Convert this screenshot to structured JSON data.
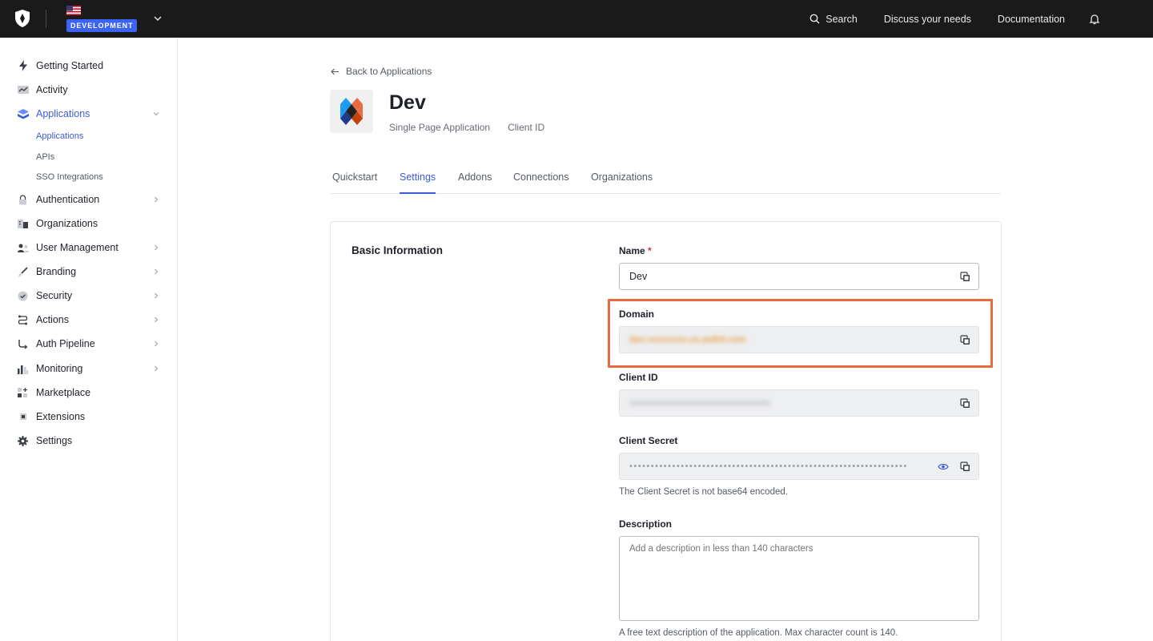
{
  "topbar": {
    "env_badge": "DEVELOPMENT",
    "search_label": "Search",
    "discuss_label": "Discuss your needs",
    "docs_label": "Documentation"
  },
  "sidebar": {
    "items": [
      {
        "label": "Getting Started",
        "icon": "bolt-icon"
      },
      {
        "label": "Activity",
        "icon": "activity-chart-icon"
      },
      {
        "label": "Applications",
        "icon": "layers-icon"
      },
      {
        "label": "Authentication",
        "icon": "lock-icon"
      },
      {
        "label": "Organizations",
        "icon": "building-icon"
      },
      {
        "label": "User Management",
        "icon": "users-icon"
      },
      {
        "label": "Branding",
        "icon": "brush-icon"
      },
      {
        "label": "Security",
        "icon": "shield-check-icon"
      },
      {
        "label": "Actions",
        "icon": "flow-icon"
      },
      {
        "label": "Auth Pipeline",
        "icon": "pipeline-icon"
      },
      {
        "label": "Monitoring",
        "icon": "bar-chart-icon"
      },
      {
        "label": "Marketplace",
        "icon": "grid-plus-icon"
      },
      {
        "label": "Extensions",
        "icon": "chip-icon"
      },
      {
        "label": "Settings",
        "icon": "gear-icon"
      }
    ],
    "sub_items": [
      "Applications",
      "APIs",
      "SSO Integrations"
    ]
  },
  "main": {
    "back_label": "Back to Applications",
    "app_title": "Dev",
    "app_type": "Single Page Application",
    "client_id_label": "Client ID",
    "tabs": [
      "Quickstart",
      "Settings",
      "Addons",
      "Connections",
      "Organizations"
    ],
    "section_title": "Basic Information",
    "fields": {
      "name_label": "Name",
      "name_required": "*",
      "name_value": "Dev",
      "domain_label": "Domain",
      "domain_value": "dev-xxxxxxxx.us.auth0.com",
      "client_id_label": "Client ID",
      "client_id_value": "xxxxxxxxxxxxxxxxxxxxxxxxxxxxxxxx",
      "client_secret_label": "Client Secret",
      "client_secret_masked": "•••••••••••••••••••••••••••••••••••••••••••••••••••••••••••••••••",
      "client_secret_help": "The Client Secret is not base64 encoded.",
      "description_label": "Description",
      "description_placeholder": "Add a description in less than 140 characters",
      "description_help": "A free text description of the application. Max character count is 140."
    }
  },
  "colors": {
    "accent": "#3b5bdb",
    "topbar": "#1a1a1a",
    "highlight": "#ea6b42",
    "badge": "#3b63f5"
  }
}
